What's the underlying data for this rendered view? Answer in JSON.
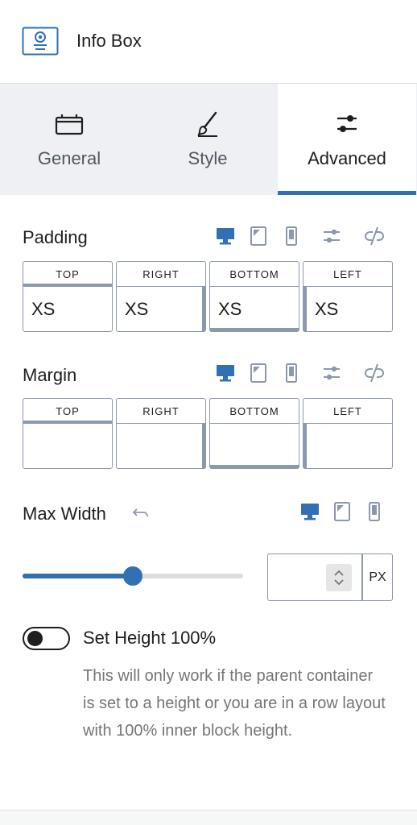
{
  "header": {
    "title": "Info Box",
    "icon": "info-box-block-icon"
  },
  "tabs": [
    {
      "label": "General",
      "icon": "briefcase-icon",
      "active": false
    },
    {
      "label": "Style",
      "icon": "paint-brush-icon",
      "active": false
    },
    {
      "label": "Advanced",
      "icon": "sliders-icon",
      "active": true
    }
  ],
  "padding": {
    "label": "Padding",
    "devices": [
      "desktop-icon",
      "tablet-icon",
      "mobile-icon"
    ],
    "active_device": "desktop",
    "sides": [
      {
        "label": "TOP",
        "value": "XS"
      },
      {
        "label": "RIGHT",
        "value": "XS"
      },
      {
        "label": "BOTTOM",
        "value": "XS"
      },
      {
        "label": "LEFT",
        "value": "XS"
      }
    ]
  },
  "margin": {
    "label": "Margin",
    "devices": [
      "desktop-icon",
      "tablet-icon",
      "mobile-icon"
    ],
    "active_device": "desktop",
    "sides": [
      {
        "label": "TOP",
        "value": ""
      },
      {
        "label": "RIGHT",
        "value": ""
      },
      {
        "label": "BOTTOM",
        "value": ""
      },
      {
        "label": "LEFT",
        "value": ""
      }
    ]
  },
  "max_width": {
    "label": "Max Width",
    "active_device": "desktop",
    "slider_percent": 50,
    "value": "",
    "unit": "PX"
  },
  "set_height": {
    "label": "Set Height 100%",
    "enabled": false,
    "help": "This will only work if the parent container is set to a height or you are in a row layout with 100% inner block height."
  },
  "colors": {
    "accent": "#3070b3",
    "muted_icon": "#8c98ab",
    "tab_bg": "#eef0f4"
  }
}
